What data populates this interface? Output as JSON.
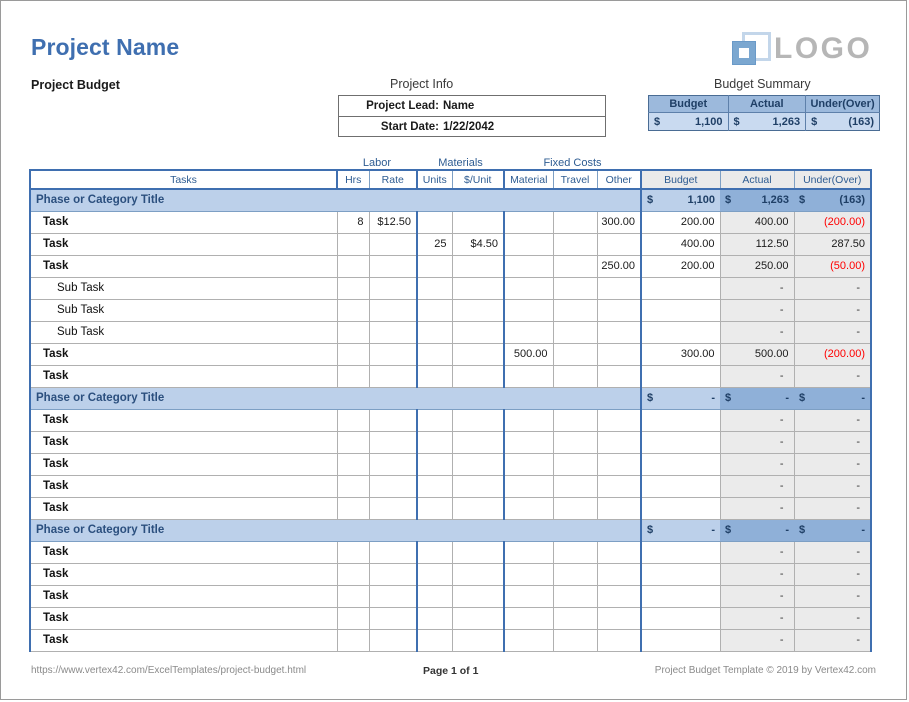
{
  "header": {
    "project_name": "Project Name",
    "subtitle": "Project Budget",
    "logo_text": "LOGO",
    "logo_icon": "overlapping-squares-icon"
  },
  "project_info": {
    "caption": "Project Info",
    "rows": [
      {
        "label": "Project Lead:",
        "value": "Name"
      },
      {
        "label": "Start Date:",
        "value": "1/22/2042"
      }
    ]
  },
  "budget_summary": {
    "caption": "Budget Summary",
    "headers": [
      "Budget",
      "Actual",
      "Under(Over)"
    ],
    "currency": "$",
    "values": [
      "1,100",
      "1,263",
      "(163)"
    ],
    "negative_flags": [
      false,
      false,
      true
    ]
  },
  "table": {
    "group_headers": [
      "Labor",
      "Materials",
      "Fixed Costs"
    ],
    "columns": [
      "Tasks",
      "Hrs",
      "Rate",
      "Units",
      "$/Unit",
      "Material",
      "Travel",
      "Other",
      "Budget",
      "Actual",
      "Under(Over)"
    ],
    "phases": [
      {
        "title": "Phase or Category Title",
        "currency": "$",
        "budget": "1,100",
        "actual": "1,263",
        "under_over": "(163)",
        "under_over_negative": true,
        "rows": [
          {
            "task": "Task",
            "sub": false,
            "hrs": "8",
            "rate": "$12.50",
            "units": "",
            "unit_cost": "",
            "material": "",
            "travel": "",
            "other": "300.00",
            "budget": "200.00",
            "actual": "400.00",
            "under_over": "(200.00)",
            "under_over_negative": true
          },
          {
            "task": "Task",
            "sub": false,
            "hrs": "",
            "rate": "",
            "units": "25",
            "unit_cost": "$4.50",
            "material": "",
            "travel": "",
            "other": "",
            "budget": "400.00",
            "actual": "112.50",
            "under_over": "287.50",
            "under_over_negative": false
          },
          {
            "task": "Task",
            "sub": false,
            "hrs": "",
            "rate": "",
            "units": "",
            "unit_cost": "",
            "material": "",
            "travel": "",
            "other": "250.00",
            "budget": "200.00",
            "actual": "250.00",
            "under_over": "(50.00)",
            "under_over_negative": true
          },
          {
            "task": "Sub Task",
            "sub": true,
            "hrs": "",
            "rate": "",
            "units": "",
            "unit_cost": "",
            "material": "",
            "travel": "",
            "other": "",
            "budget": "",
            "actual": "-",
            "under_over": "-",
            "under_over_negative": false
          },
          {
            "task": "Sub Task",
            "sub": true,
            "hrs": "",
            "rate": "",
            "units": "",
            "unit_cost": "",
            "material": "",
            "travel": "",
            "other": "",
            "budget": "",
            "actual": "-",
            "under_over": "-",
            "under_over_negative": false
          },
          {
            "task": "Sub Task",
            "sub": true,
            "hrs": "",
            "rate": "",
            "units": "",
            "unit_cost": "",
            "material": "",
            "travel": "",
            "other": "",
            "budget": "",
            "actual": "-",
            "under_over": "-",
            "under_over_negative": false
          },
          {
            "task": "Task",
            "sub": false,
            "hrs": "",
            "rate": "",
            "units": "",
            "unit_cost": "",
            "material": "500.00",
            "travel": "",
            "other": "",
            "budget": "300.00",
            "actual": "500.00",
            "under_over": "(200.00)",
            "under_over_negative": true
          },
          {
            "task": "Task",
            "sub": false,
            "hrs": "",
            "rate": "",
            "units": "",
            "unit_cost": "",
            "material": "",
            "travel": "",
            "other": "",
            "budget": "",
            "actual": "-",
            "under_over": "-",
            "under_over_negative": false
          }
        ]
      },
      {
        "title": "Phase or Category Title",
        "currency": "$",
        "budget": "-",
        "actual": "-",
        "under_over": "-",
        "under_over_negative": false,
        "rows": [
          {
            "task": "Task",
            "sub": false,
            "hrs": "",
            "rate": "",
            "units": "",
            "unit_cost": "",
            "material": "",
            "travel": "",
            "other": "",
            "budget": "",
            "actual": "-",
            "under_over": "-",
            "under_over_negative": false
          },
          {
            "task": "Task",
            "sub": false,
            "hrs": "",
            "rate": "",
            "units": "",
            "unit_cost": "",
            "material": "",
            "travel": "",
            "other": "",
            "budget": "",
            "actual": "-",
            "under_over": "-",
            "under_over_negative": false
          },
          {
            "task": "Task",
            "sub": false,
            "hrs": "",
            "rate": "",
            "units": "",
            "unit_cost": "",
            "material": "",
            "travel": "",
            "other": "",
            "budget": "",
            "actual": "-",
            "under_over": "-",
            "under_over_negative": false
          },
          {
            "task": "Task",
            "sub": false,
            "hrs": "",
            "rate": "",
            "units": "",
            "unit_cost": "",
            "material": "",
            "travel": "",
            "other": "",
            "budget": "",
            "actual": "-",
            "under_over": "-",
            "under_over_negative": false
          },
          {
            "task": "Task",
            "sub": false,
            "hrs": "",
            "rate": "",
            "units": "",
            "unit_cost": "",
            "material": "",
            "travel": "",
            "other": "",
            "budget": "",
            "actual": "-",
            "under_over": "-",
            "under_over_negative": false
          }
        ]
      },
      {
        "title": "Phase or Category Title",
        "currency": "$",
        "budget": "-",
        "actual": "-",
        "under_over": "-",
        "under_over_negative": false,
        "rows": [
          {
            "task": "Task",
            "sub": false,
            "hrs": "",
            "rate": "",
            "units": "",
            "unit_cost": "",
            "material": "",
            "travel": "",
            "other": "",
            "budget": "",
            "actual": "-",
            "under_over": "-",
            "under_over_negative": false
          },
          {
            "task": "Task",
            "sub": false,
            "hrs": "",
            "rate": "",
            "units": "",
            "unit_cost": "",
            "material": "",
            "travel": "",
            "other": "",
            "budget": "",
            "actual": "-",
            "under_over": "-",
            "under_over_negative": false
          },
          {
            "task": "Task",
            "sub": false,
            "hrs": "",
            "rate": "",
            "units": "",
            "unit_cost": "",
            "material": "",
            "travel": "",
            "other": "",
            "budget": "",
            "actual": "-",
            "under_over": "-",
            "under_over_negative": false
          },
          {
            "task": "Task",
            "sub": false,
            "hrs": "",
            "rate": "",
            "units": "",
            "unit_cost": "",
            "material": "",
            "travel": "",
            "other": "",
            "budget": "",
            "actual": "-",
            "under_over": "-",
            "under_over_negative": false
          },
          {
            "task": "Task",
            "sub": false,
            "hrs": "",
            "rate": "",
            "units": "",
            "unit_cost": "",
            "material": "",
            "travel": "",
            "other": "",
            "budget": "",
            "actual": "-",
            "under_over": "-",
            "under_over_negative": false
          }
        ]
      }
    ]
  },
  "footer": {
    "url": "https://www.vertex42.com/ExcelTemplates/project-budget.html",
    "page": "Page 1 of 1",
    "copyright": "Project Budget Template © 2019 by Vertex42.com"
  },
  "colors": {
    "accent": "#3f6fb0",
    "title": "#3f6fb0",
    "phase_bg": "#bcd0ea",
    "phase_bg_dark": "#8fb0d8",
    "negative": "#ff0000"
  }
}
